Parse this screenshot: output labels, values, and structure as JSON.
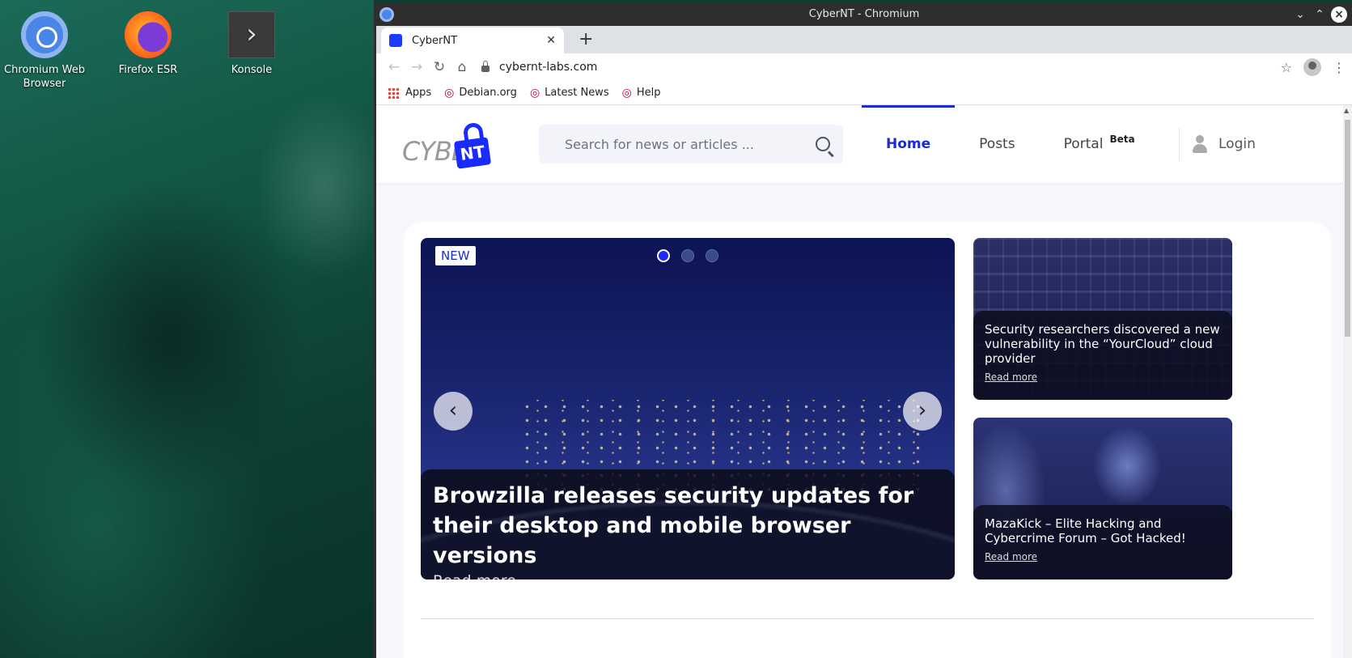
{
  "desktop": {
    "icons": [
      {
        "label": "Chromium Web Browser"
      },
      {
        "label": "Firefox ESR"
      },
      {
        "label": "Konsole"
      }
    ]
  },
  "window": {
    "title": "CyberNT - Chromium",
    "tab_title": "CyberNT",
    "url": "cybernt-labs.com",
    "bookmarks": [
      "Apps",
      "Debian.org",
      "Latest News",
      "Help"
    ]
  },
  "site": {
    "logo_text": "CYBER",
    "logo_mark": "NT",
    "search_placeholder": "Search for news or articles ...",
    "nav": {
      "home": "Home",
      "posts": "Posts",
      "portal": "Portal",
      "beta": "Beta"
    },
    "login": "Login",
    "hero": {
      "badge": "NEW",
      "title": "Browzilla releases security updates for their desktop and mobile browser versions",
      "read_more": "Read more",
      "slides": 3,
      "active_slide": 1
    },
    "side_articles": [
      {
        "title": "Security researchers discovered a new vulnerability in the “YourCloud” cloud provider",
        "read_more": "Read more"
      },
      {
        "title": "MazaKick – Elite Hacking and Cybercrime Forum – Got Hacked!",
        "read_more": "Read more"
      }
    ]
  },
  "colors": {
    "accent": "#1a2bd6",
    "titlebar": "#2e2e2e",
    "tabstrip": "#dee1e6"
  }
}
